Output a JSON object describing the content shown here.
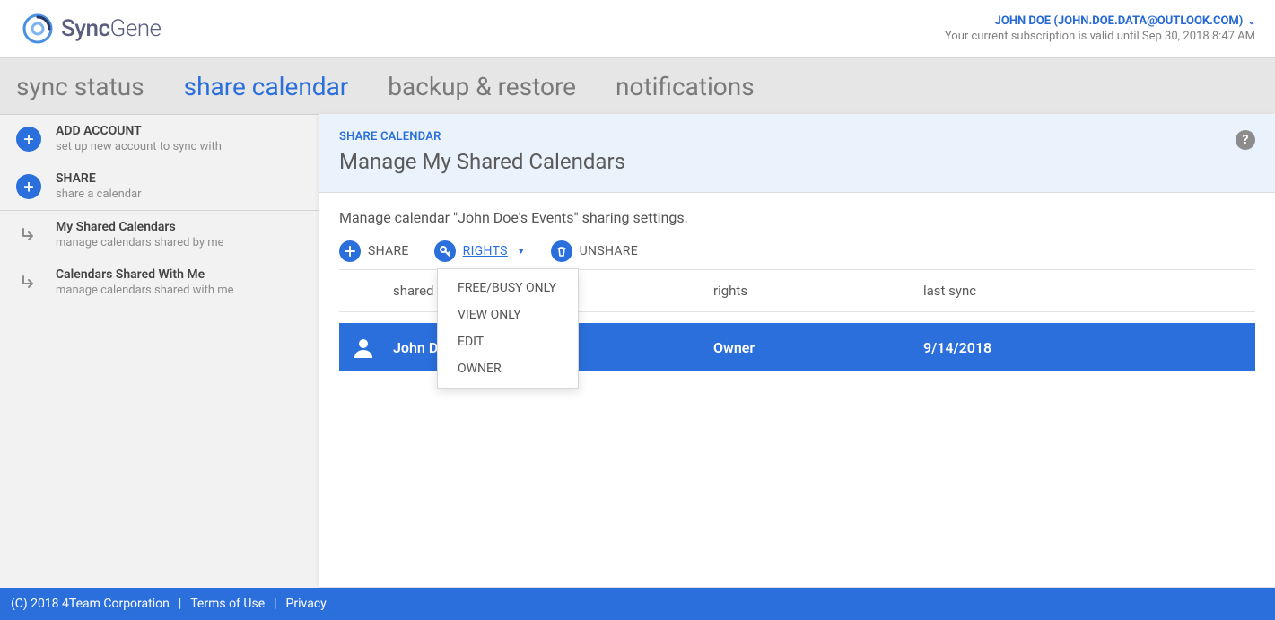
{
  "brand": {
    "name_main": "Sync",
    "name_sub": "Gene"
  },
  "header": {
    "user_label": "JOHN DOE (JOHN.DOE.DATA@OUTLOOK.COM)",
    "subscription_text": "Your current subscription is valid until Sep 30, 2018 8:47 AM"
  },
  "tabs": {
    "sync_status": "sync status",
    "share_calendar": "share calendar",
    "backup_restore": "backup & restore",
    "notifications": "notifications"
  },
  "sidebar": {
    "add_account": {
      "title": "ADD ACCOUNT",
      "subtitle": "set up new account to sync with"
    },
    "share": {
      "title": "SHARE",
      "subtitle": "share a calendar"
    },
    "my_shared": {
      "title": "My Shared Calendars",
      "subtitle": "manage calendars shared by me"
    },
    "shared_with_me": {
      "title": "Calendars Shared With Me",
      "subtitle": "manage calendars shared with me"
    }
  },
  "content": {
    "breadcrumb": "SHARE CALENDAR",
    "title": "Manage My Shared Calendars",
    "description": "Manage calendar \"John Doe's Events\" sharing settings.",
    "actions": {
      "share": "SHARE",
      "rights": "RIGHTS",
      "unshare": "UNSHARE"
    },
    "columns": {
      "shared_with": "shared with",
      "rights": "rights",
      "last_sync": "last sync"
    },
    "rows": [
      {
        "shared_with": "John Doe",
        "rights": "Owner",
        "last_sync": "9/14/2018"
      }
    ],
    "rights_menu": {
      "free_busy": "FREE/BUSY ONLY",
      "view_only": "VIEW ONLY",
      "edit": "EDIT",
      "owner": "OWNER"
    }
  },
  "footer": {
    "copyright": "(C) 2018  4Team Corporation",
    "terms": "Terms of Use",
    "privacy": "Privacy"
  }
}
